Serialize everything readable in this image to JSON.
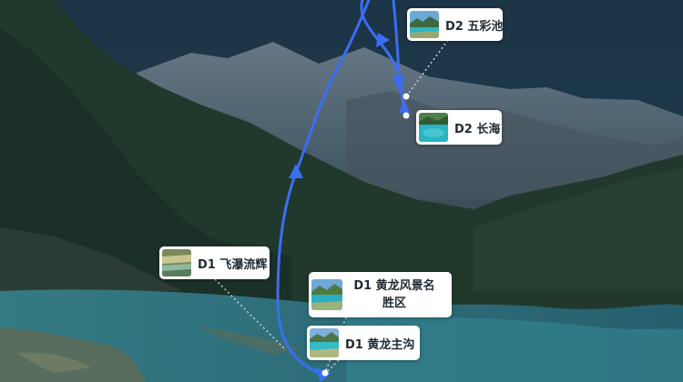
{
  "map": {
    "markers": [
      {
        "id": "d2-wucaichi",
        "label": "D2 五彩池",
        "thumbnail": "lake-thumbnail"
      },
      {
        "id": "d2-changhai",
        "label": "D2 长海",
        "thumbnail": "lake-thumbnail"
      },
      {
        "id": "d1-feipuliuhui",
        "label": "D1 飞瀑流辉",
        "thumbnail": "terrace-thumbnail"
      },
      {
        "id": "d1-huanglong-scenic",
        "label": "D1 黄龙风景名胜区",
        "thumbnail": "lake-thumbnail"
      },
      {
        "id": "d1-huanglong-main",
        "label": "D1 黄龙主沟",
        "thumbnail": "lake-thumbnail"
      }
    ],
    "route": {
      "color": "#3b6ef5",
      "direction_arrows": "arrow-icon"
    },
    "leader_color": "#d8dde2"
  }
}
